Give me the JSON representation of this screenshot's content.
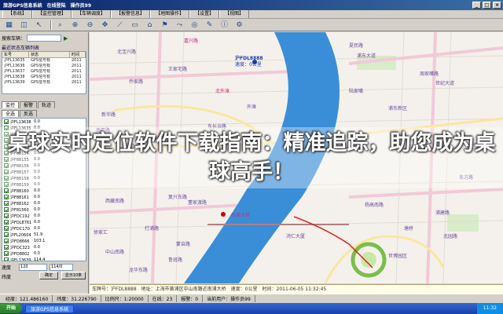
{
  "window": {
    "title": "旅游GPS信息系统　在线登陆　操作员99",
    "min": "_",
    "max": "□",
    "close": "×"
  },
  "menu": [
    "【系统】",
    "【监控管理】",
    "【车辆调度】",
    "【报警信息】",
    "【地图操作】",
    "【设置】",
    "【视图】"
  ],
  "toolbar_icons": [
    "layers-icon",
    "lock-icon",
    "cursor-icon",
    "magnify-icon",
    "zoom-in-icon",
    "zoom-out-icon",
    "pan-icon",
    "measure-icon",
    "car-icon",
    "home-icon",
    "flag-icon",
    "route-icon",
    "target-icon",
    "note-icon",
    "info-icon",
    "tool-icon"
  ],
  "left": {
    "search_label": "搜索车辆：",
    "list_caption": "最近状态车辆列表",
    "columns": [
      "车号",
      "状态",
      "时间"
    ],
    "rows": [
      [
        "沪FL13635",
        "GPS信号有",
        "2011"
      ],
      [
        "沪FL13636",
        "GPS信号有",
        "2011"
      ],
      [
        "沪FL13637",
        "GPS信号有",
        "2011"
      ],
      [
        "沪FL13638",
        "GPS信号有",
        "2011"
      ],
      [
        "沪FL13639",
        "GPS信号有",
        "2011"
      ]
    ],
    "tabs": [
      "监控",
      "报警",
      "轨迹"
    ],
    "subtabs": [
      "全选",
      "反选"
    ],
    "vehicles": [
      [
        "沪FL13638",
        "0.0"
      ],
      [
        "沪FL13635",
        "0.0"
      ],
      [
        "沪FP28061",
        "0.0"
      ],
      [
        "沪F88152",
        "0.0"
      ],
      [
        "沪F88153",
        "0.0"
      ],
      [
        "沪F88154",
        "0.0"
      ],
      [
        "沪F88155",
        "0.0"
      ],
      [
        "沪F88156",
        "0.0"
      ],
      [
        "沪F88157",
        "0.0"
      ],
      [
        "沪F88158",
        "0.0"
      ],
      [
        "沪F88159",
        "0.0"
      ],
      [
        "沪F88160",
        "0.0"
      ],
      [
        "沪F88161",
        "0.0"
      ],
      [
        "沪F88162",
        "0.0"
      ],
      [
        "沪F81560",
        "0.0"
      ],
      [
        "沪FDC192",
        "0.0"
      ],
      [
        "沪FDL8761",
        "0.0"
      ],
      [
        "沪FDC170",
        "0.0"
      ],
      [
        "沪FL20604",
        "51.9"
      ],
      [
        "沪FD8666",
        "103.1"
      ],
      [
        "沪FDC323",
        "0.0"
      ],
      [
        "沪FD8802",
        "0.0"
      ],
      [
        "沪FL13639",
        "114.4"
      ]
    ],
    "speed_label": "速度",
    "speed_value": "120",
    "lon_label": "经度",
    "lon_value": "114/0",
    "lat_label": "纬度",
    "btn_go": "确定",
    "btn_show": "显示10条"
  },
  "map": {
    "labels": [
      "沪FDL8888",
      "速度：0公里",
      "嘉兴路",
      "夏民路",
      "王家宅路",
      "北宝兴路",
      "乔家路",
      "新华路",
      "北外滩",
      "周家嘴路",
      "海宁路",
      "东长治路",
      "外滩",
      "陆家嘴",
      "南京路",
      "延安东路",
      "浦东新区",
      "世纪大道",
      "张杨路",
      "浦东大道",
      "西藏南路",
      "复兴东路",
      "中山南路",
      "南浦大桥",
      "董家渡路",
      "龙华东路",
      "蒙自路",
      "徐家汇",
      "打浦路",
      "鲁班路",
      "鸿仁大厦",
      "杨高南路",
      "浦建路",
      "北园路",
      "塘桥",
      "东方路",
      "世博园区"
    ]
  },
  "headline": "桌球实时定位软件下载指南：精准追踪，助您成为桌球高手！",
  "status_text": "车牌号：沪FDL8888　地址：上海市黄浦区中山南路近南浦大桥　速度：0公里　时间：2011-06-05 11:32:45",
  "coords": [
    "经度：121.486160",
    "纬度：31.226790",
    "比例尺：1:20000",
    "在线：23",
    "报警：0",
    "当前用户：操作员99"
  ],
  "taskbar": {
    "start": "开始",
    "task": "旅游GPS信息系统",
    "clock": "11:32"
  }
}
